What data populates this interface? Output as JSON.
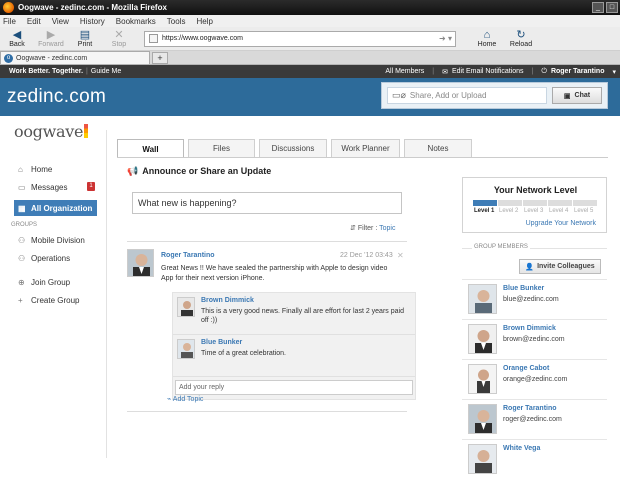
{
  "browser": {
    "window_title": "Oogwave - zedinc.com - Mozilla Firefox",
    "menu": [
      "File",
      "Edit",
      "View",
      "History",
      "Bookmarks",
      "Tools",
      "Help"
    ],
    "nav": {
      "back": "Back",
      "forward": "Forward",
      "print": "Print",
      "stop": "Stop",
      "home": "Home",
      "reload": "Reload"
    },
    "url": "https://www.oogwave.com",
    "tab_title": "Oogwave - zedinc.com",
    "new_tab": "+"
  },
  "appbar": {
    "tagline": "Work Better. Together.",
    "guide": "Guide Me",
    "all_members": "All Members",
    "edit_notifications": "Edit Email Notifications",
    "user": "Roger Tarantino"
  },
  "brand": {
    "name": "zedinc.com",
    "share_placeholder": "Share, Add or Upload",
    "chat": "Chat"
  },
  "sidebar": {
    "logo": "oogwave",
    "items": [
      {
        "label": "Home",
        "icon": "home-icon"
      },
      {
        "label": "Messages",
        "icon": "messages-icon",
        "badge": "1"
      },
      {
        "label": "All Organization",
        "icon": "organization-icon",
        "active": true
      }
    ],
    "groups_header": "GROUPS",
    "groups": [
      {
        "label": "Mobile Division",
        "icon": "group-icon"
      },
      {
        "label": "Operations",
        "icon": "group-icon"
      }
    ],
    "actions": [
      {
        "label": "Join Group",
        "icon": "join-group-icon"
      },
      {
        "label": "Create Group",
        "icon": "plus-icon"
      }
    ]
  },
  "tabs": [
    "Wall",
    "Files",
    "Discussions",
    "Work Planner",
    "Notes"
  ],
  "wall": {
    "heading": "Announce or Share an Update",
    "input_value": "What new is happening?",
    "filter_label": "Filter :",
    "filter_value": "Topic",
    "post": {
      "author": "Roger Tarantino",
      "date": "22 Dec '12 03:43",
      "text": "Great News !! We have sealed the partnership with Apple to design video App for their next version iPhone."
    },
    "comments": [
      {
        "author": "Brown Dimmick",
        "text": "This is a very good news. Finally all are effort for last 2 years paid off :))"
      },
      {
        "author": "Blue Bunker",
        "text": "Time of a great celebration."
      }
    ],
    "reply_placeholder": "Add your reply",
    "add_topic": "Add Topic"
  },
  "network": {
    "title": "Your Network Level",
    "levels": [
      "Level 1",
      "Level 2",
      "Level 3",
      "Level 4",
      "Level 5"
    ],
    "current_level": 1,
    "upgrade": "Upgrade Your Network"
  },
  "group_members": {
    "header": "GROUP MEMBERS",
    "invite": "Invite Colleagues",
    "members": [
      {
        "name": "Blue Bunker",
        "email": "blue@zedinc.com"
      },
      {
        "name": "Brown Dimmick",
        "email": "brown@zedinc.com"
      },
      {
        "name": "Orange Cabot",
        "email": "orange@zedinc.com"
      },
      {
        "name": "Roger Tarantino",
        "email": "roger@zedinc.com"
      },
      {
        "name": "White Vega",
        "email": ""
      }
    ]
  }
}
